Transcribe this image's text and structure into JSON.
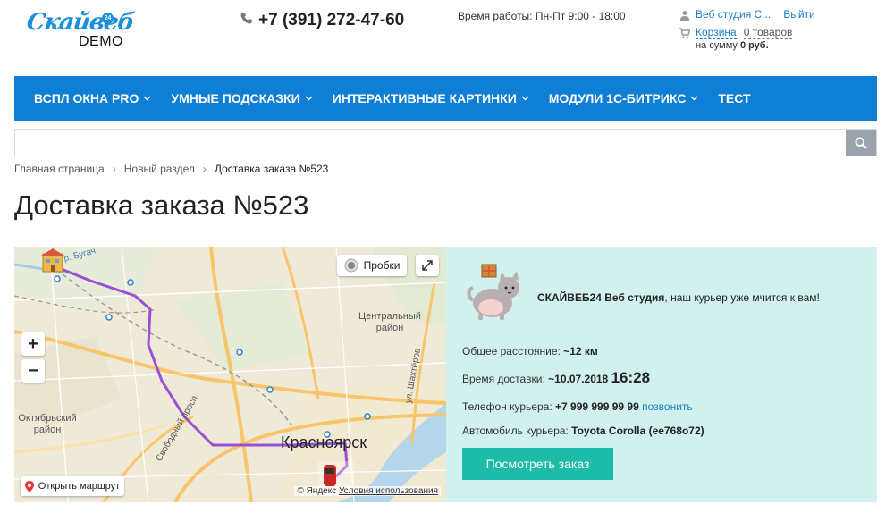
{
  "header": {
    "logo_script": "Скайвеб",
    "logo_badge": "24",
    "logo_demo": "DEMO",
    "phone": "+7 (391) 272-47-60",
    "hours": "Время работы: Пн-Пт 9:00 - 18:00",
    "user_name": "Веб студия С...",
    "logout": "Выйти",
    "cart_label": "Корзина",
    "cart_count": "0 товаров",
    "cart_sum_prefix": "на сумму",
    "cart_sum_value": "0 руб."
  },
  "nav": {
    "items": [
      {
        "label": "ВСПЛ ОКНА PRO",
        "has_dropdown": true
      },
      {
        "label": "УМНЫЕ ПОДСКАЗКИ",
        "has_dropdown": true
      },
      {
        "label": "ИНТЕРАКТИВНЫЕ КАРТИНКИ",
        "has_dropdown": true
      },
      {
        "label": "МОДУЛИ 1С-БИТРИКС",
        "has_dropdown": true
      },
      {
        "label": "ТЕСТ",
        "has_dropdown": false
      }
    ]
  },
  "search": {
    "value": "",
    "placeholder": ""
  },
  "breadcrumb": {
    "items": [
      "Главная страница",
      "Новый раздел",
      "Доставка заказа №523"
    ],
    "separator": "›"
  },
  "page_title": "Доставка заказа №523",
  "map": {
    "traffic_label": "Пробки",
    "zoom_in": "+",
    "zoom_out": "−",
    "open_route": "Открыть маршрут",
    "copyright": "© Яндекс",
    "terms": "Условия использования",
    "labels": {
      "district_central": "Центральный район",
      "district_oktyabr": "Октябрьский район",
      "city": "Красноярск",
      "street_shakhterov": "ул. Шахтёров",
      "prospect_svobodny": "Свободный просп.",
      "river_bugach": "р. Бугач"
    },
    "route_color": "#9b4fd6"
  },
  "delivery": {
    "company": "СКАЙВЕБ24 Веб студия",
    "courier_message": ", наш курьер уже мчится к вам!",
    "distance_label": "Общее расстояние:",
    "distance_value": "~12 км",
    "time_label": "Время доставки:",
    "time_date": "~10.07.2018",
    "time_hour": "16:28",
    "phone_label": "Телефон курьера:",
    "phone_value": "+7 999 999 99 99",
    "call_link": "позвонить",
    "car_label": "Автомобиль курьера:",
    "car_value": "Toyota Corolla (ее768о72)",
    "view_order_button": "Посмотреть заказ"
  },
  "colors": {
    "nav_bg": "#0e7fd4",
    "panel_bg": "#d1f1ee",
    "button_bg": "#1dbba8",
    "link": "#1b7ec6"
  }
}
